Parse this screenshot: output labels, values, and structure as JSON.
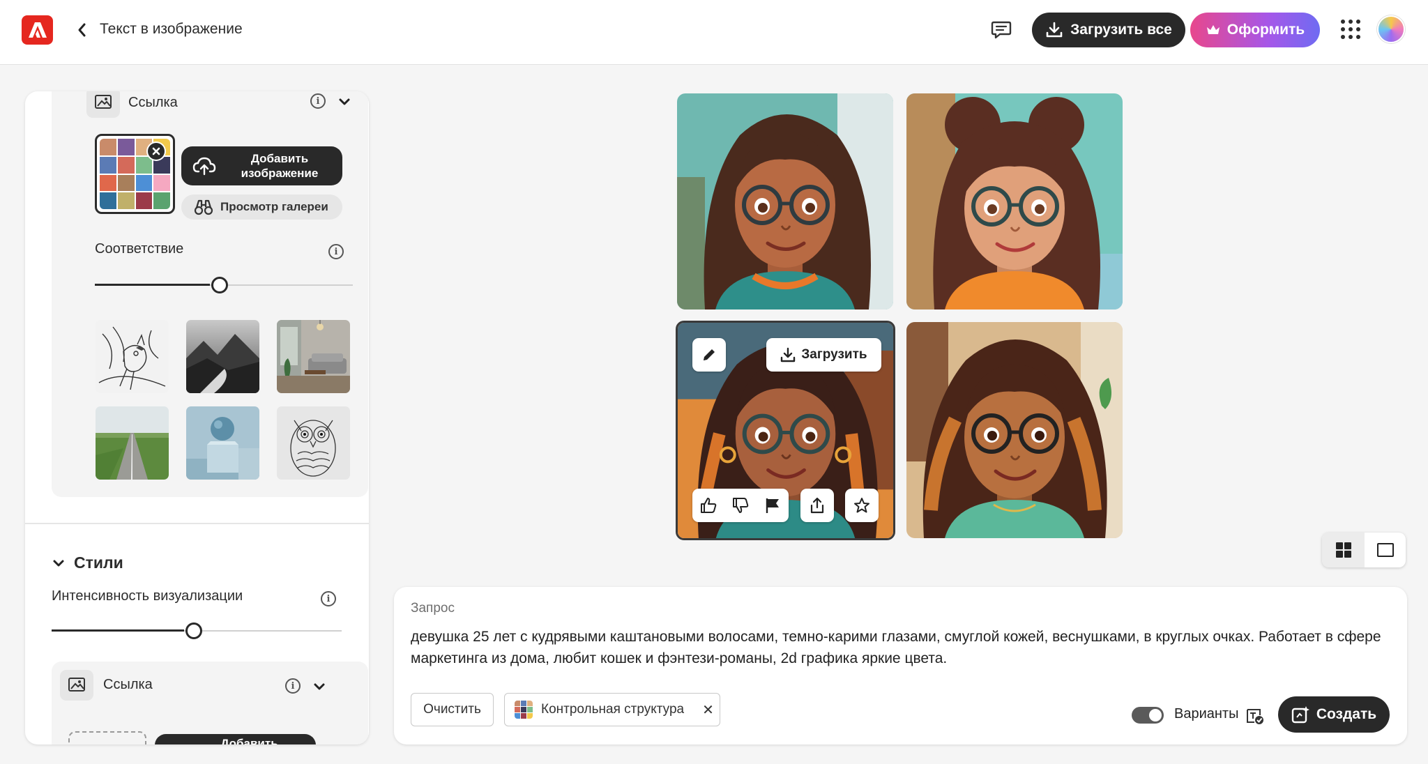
{
  "header": {
    "title": "Текст в изображение",
    "download_all": "Загрузить все",
    "subscribe": "Оформить"
  },
  "panel": {
    "reference": {
      "label": "Ссылка",
      "add_image": "Добавить изображение",
      "browse_gallery": "Просмотр галереи"
    },
    "match": {
      "label": "Соответствие",
      "value": 0.5
    },
    "style_presets": [
      "bird-sketch",
      "mountain-landscape",
      "living-room",
      "green-road",
      "sphere-cube",
      "owl-sketch"
    ],
    "styles": {
      "heading": "Стили",
      "intensity_label": "Интенсивность визуализации",
      "intensity_value": 0.5,
      "reference_label": "Ссылка",
      "add_image_partial": "Добавить"
    }
  },
  "images": {
    "download": "Загрузить",
    "items": [
      {
        "skin": "#b86a43",
        "hair": "#4a2a1d",
        "shirt": "#2e8f8a",
        "bg": "#6fb8b0"
      },
      {
        "skin": "#e0a07a",
        "hair": "#5a2e22",
        "shirt": "#f08a2c",
        "bg": "#77c7be"
      },
      {
        "skin": "#a8603d",
        "hair": "#3a1f18",
        "shirt": "#2d8b86",
        "bg": "#e08a3a"
      },
      {
        "skin": "#b8703f",
        "hair": "#4a2518",
        "shirt": "#5bb89a",
        "bg": "#d9b98e"
      }
    ]
  },
  "prompt": {
    "label": "Запрос",
    "text": "девушка 25 лет с кудрявыми каштановыми волосами, темно-карими глазами, смуглой кожей, веснушками, в круглых очках. Работает в сфере маркетинга из дома, любит кошек и фэнтези-романы, 2d графика яркие цвета.",
    "clear": "Очистить",
    "structure_chip": "Контрольная структура",
    "variants": "Варианты",
    "create": "Создать"
  },
  "colors": {
    "accent": "#e5271f",
    "dark": "#292929"
  }
}
